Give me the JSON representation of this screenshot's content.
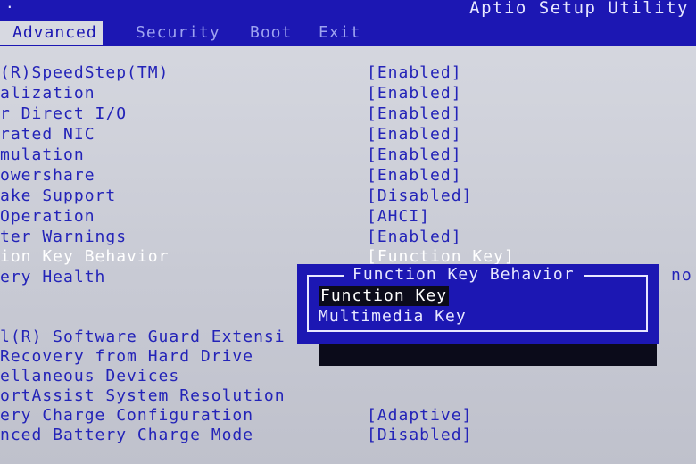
{
  "window": {
    "title": "Aptio Setup Utility",
    "corner_mark": "."
  },
  "tabs": [
    {
      "label": "Advanced",
      "active": true
    },
    {
      "label": "Security",
      "active": false
    },
    {
      "label": "Boot",
      "active": false
    },
    {
      "label": "Exit",
      "active": false
    }
  ],
  "settings": [
    {
      "label": "(R)SpeedStep(TM)",
      "value": "[Enabled]"
    },
    {
      "label": "alization",
      "value": "[Enabled]"
    },
    {
      "label": "r Direct I/O",
      "value": "[Enabled]"
    },
    {
      "label": "rated NIC",
      "value": "[Enabled]"
    },
    {
      "label": "mulation",
      "value": "[Enabled]"
    },
    {
      "label": "owershare",
      "value": "[Enabled]"
    },
    {
      "label": "ake Support",
      "value": "[Disabled]"
    },
    {
      "label": " Operation",
      "value": "[AHCI]"
    },
    {
      "label": "ter Warnings",
      "value": "[Enabled]"
    },
    {
      "label": "ion Key Behavior",
      "value": "[Function Key]",
      "selected": true
    },
    {
      "label": "ery Health",
      "value": ""
    },
    {
      "label": "l(R) Software Guard Extensi",
      "value": ""
    },
    {
      "label": " Recovery from Hard Drive",
      "value": ""
    },
    {
      "label": "ellaneous Devices",
      "value": ""
    },
    {
      "label": "ortAssist System Resolution",
      "value": ""
    },
    {
      "label": "ery Charge Configuration",
      "value": "[Adaptive]"
    },
    {
      "label": "nced Battery Charge Mode",
      "value": "[Disabled]"
    }
  ],
  "side_fragment": "no",
  "popup": {
    "title": "Function Key Behavior",
    "options": [
      "Function Key",
      "Multimedia Key"
    ],
    "highlighted_index": 0
  },
  "colors": {
    "header_blue": "#1c17b3",
    "body_bg": "#d7d9e1",
    "text_blue": "#2323b8",
    "highlight_black": "#0b0b1a"
  }
}
